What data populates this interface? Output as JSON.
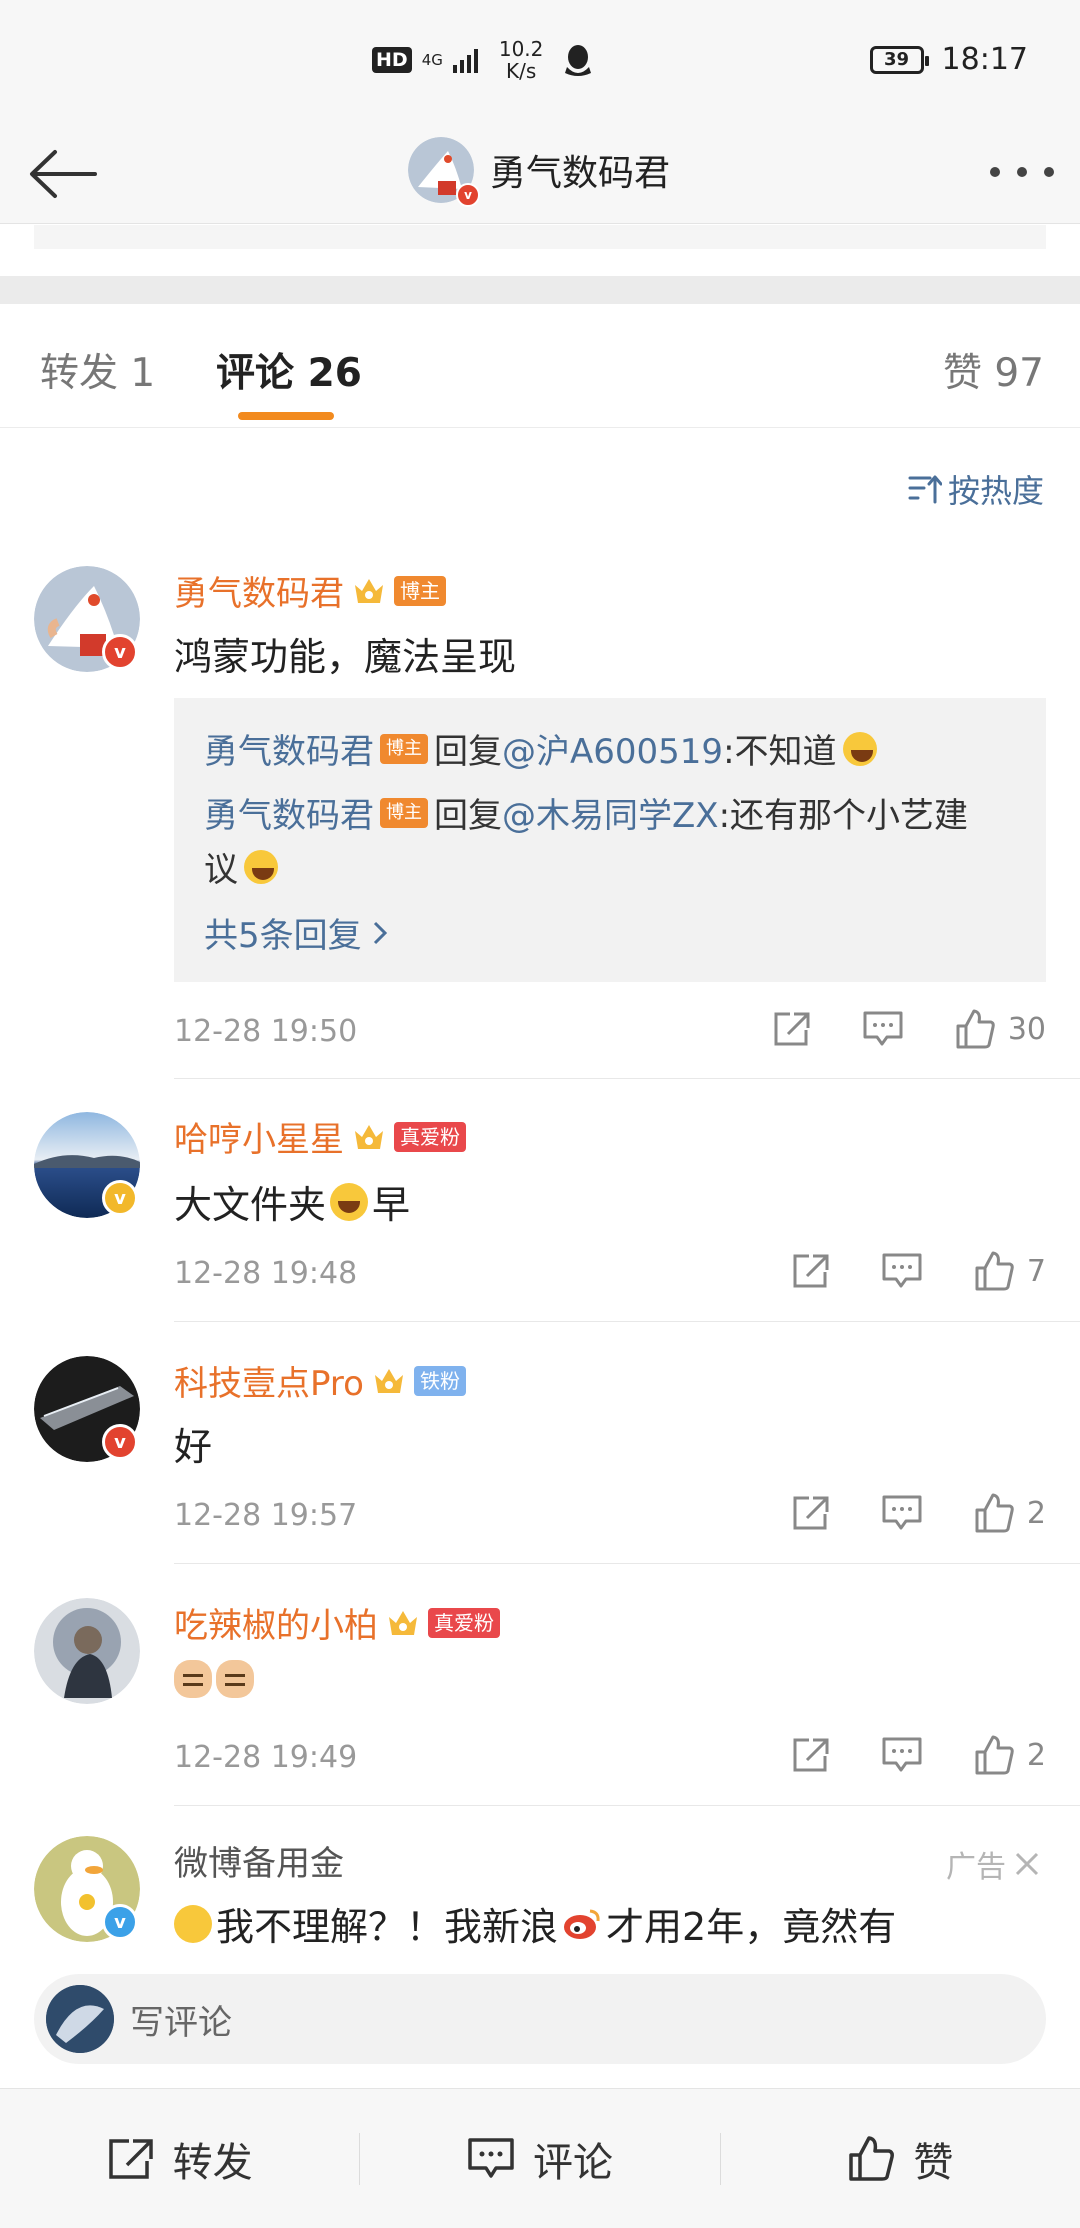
{
  "status_bar": {
    "hd": "HD",
    "network": "4G",
    "speed_value": "10.2",
    "speed_unit": "K/s",
    "battery": "39",
    "time": "18:17"
  },
  "nav": {
    "title": "勇气数码君"
  },
  "tabs": {
    "repost": "转发 1",
    "comments": "评论 26",
    "likes": "赞 97"
  },
  "sort": {
    "label": "按热度"
  },
  "comments": [
    {
      "name": "勇气数码君",
      "tag": "博主",
      "text": "鸿蒙功能，魔法呈现",
      "time": "12-28 19:50",
      "likes": "30",
      "replies": [
        {
          "name": "勇气数码君",
          "tag": "博主",
          "prefix": "回复",
          "at": "@沪A600519",
          "text": ":不知道"
        },
        {
          "name": "勇气数码君",
          "tag": "博主",
          "prefix": "回复",
          "at": "@木易同学ZX",
          "text": ":还有那个小艺建",
          "text2": "议"
        }
      ],
      "replies_more": "共5条回复"
    },
    {
      "name": "哈哼小星星",
      "tag": "真爱粉",
      "text_a": "大文件夹",
      "text_b": "早",
      "time": "12-28 19:48",
      "likes": "7"
    },
    {
      "name": "科技壹点Pro",
      "tag": "铁粉",
      "text": "好",
      "time": "12-28 19:57",
      "likes": "2"
    },
    {
      "name": "吃辣椒的小柏",
      "tag": "真爱粉",
      "time": "12-28 19:49",
      "likes": "2"
    },
    {
      "name": "微博备用金",
      "ad_label": "广告",
      "text_a": "我不理解？！我新浪",
      "text_b": "才用2年，竟然有"
    }
  ],
  "write_comment": {
    "placeholder": "写评论"
  },
  "bottom_bar": {
    "repost": "转发",
    "comment": "评论",
    "like": "赞"
  },
  "colors": {
    "accent_orange": "#f28a1e",
    "name_orange": "#e8712a",
    "link_blue": "#4a6f99"
  }
}
